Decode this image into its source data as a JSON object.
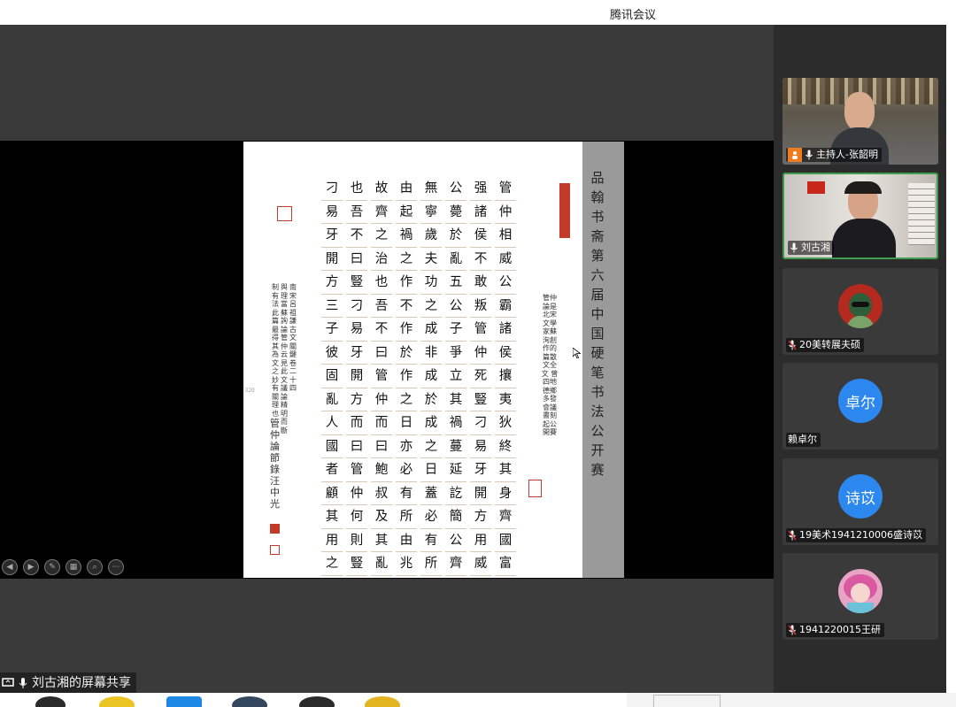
{
  "window": {
    "title": "腾讯会议"
  },
  "slide": {
    "grey_title": "品翰书斋第六届中国硬笔书法公开赛",
    "columns": [
      "管仲相威公霸諸侯攘夷狄終其身齊國富",
      "强諸侯不敢叛管仲死豎刁易牙開方用威",
      "公薨於亂五公子爭立其禍蔓延訖簡公齊",
      "無寧歲夫功之成非成於成之日蓋必有所",
      "由起禍之作不作於作之日亦必有所由兆",
      "故齊之治也吾不曰管仲而曰鮑叔及其亂",
      "也吾不曰豎刁易牙開方而曰管仲何則豎",
      "刁易牙開方三子彼固亂人國者顧其用之"
    ],
    "right_note": "管仲論是北宋文學家蘇洵創作的篇散文全文 曾四地德鄉多發會議書刻起公開賽",
    "left_note_1": "南宋呂祖謙古文關鍵卷二十四",
    "left_note_2": "與理當蘇詢論管仲云見此文議論精明而斷",
    "left_note_3": "制有法此篇最得其為文之妙有關理也",
    "signature": "管仲論節錄 汪中光",
    "page_number": "320"
  },
  "controls": [
    "◀",
    "▶",
    "✎",
    "▦",
    "⌕",
    "⋯"
  ],
  "share_banner": "刘古湘的屏幕共享",
  "participants": [
    {
      "name": "主持人-张韶明",
      "type": "video",
      "host": true
    },
    {
      "name": "刘古湘",
      "type": "video",
      "active": true
    },
    {
      "name": "20美转展夫硕",
      "type": "avatar",
      "avatar_text": "",
      "color": "#b42a1f"
    },
    {
      "name": "赖卓尔",
      "type": "avatar",
      "avatar_text": "卓尔",
      "color": "#2c88ee"
    },
    {
      "name": "19美术1941210006盛诗苡",
      "type": "avatar",
      "avatar_text": "诗苡",
      "color": "#2c88ee"
    },
    {
      "name": "1941220015王研",
      "type": "avatar",
      "avatar_text": "",
      "color": "#e7a4c4"
    }
  ]
}
